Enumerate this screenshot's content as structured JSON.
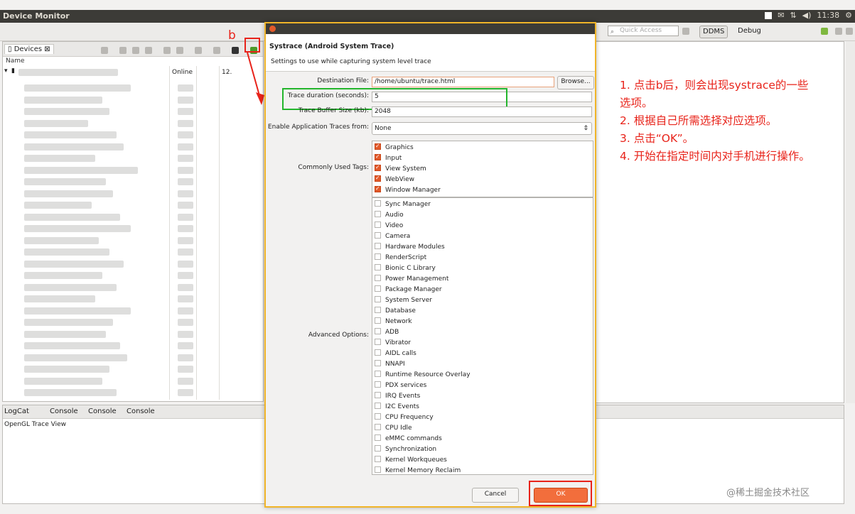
{
  "window": {
    "title": "Device Monitor"
  },
  "topbar": {
    "time": "11:38"
  },
  "toolbar": {
    "quick_access_placeholder": "Quick Access",
    "ddms_label": "DDMS",
    "debug_label": "Debug"
  },
  "devices": {
    "tab_label": "Devices",
    "col_name": "Name",
    "first_row_status": "Online",
    "first_row_version": "12."
  },
  "console_area": {
    "tabs": [
      "LogCat",
      "Console",
      "Console",
      "Console"
    ],
    "view_label": "OpenGL Trace View"
  },
  "annotation": {
    "marker": "b",
    "lines": [
      "1. 点击b后，则会出现systrace的一些",
      "选项。",
      "2. 根据自己所需选择对应选项。",
      "3. 点击“OK”。",
      "4. 开始在指定时间内对手机进行操作。"
    ]
  },
  "dialog": {
    "title": "Systrace (Android System Trace)",
    "subtitle": "Settings to use while capturing system level trace",
    "destination_label": "Destination File:",
    "destination_value": "/home/ubuntu/trace.html",
    "browse_label": "Browse...",
    "duration_label": "Trace duration (seconds):",
    "duration_value": "5",
    "buffer_label": "Trace Buffer Size (kb):",
    "buffer_value": "2048",
    "app_traces_label": "Enable Application Traces from:",
    "app_traces_value": "None",
    "common_label": "Commonly Used Tags:",
    "common_tags": [
      "Graphics",
      "Input",
      "View System",
      "WebView",
      "Window Manager"
    ],
    "advanced_label": "Advanced Options:",
    "advanced_tags": [
      "Sync Manager",
      "Audio",
      "Video",
      "Camera",
      "Hardware Modules",
      "RenderScript",
      "Bionic C Library",
      "Power Management",
      "Package Manager",
      "System Server",
      "Database",
      "Network",
      "ADB",
      "Vibrator",
      "AIDL calls",
      "NNAPI",
      "Runtime Resource Overlay",
      "PDX services",
      "IRQ Events",
      "I2C Events",
      "CPU Frequency",
      "CPU Idle",
      "eMMC commands",
      "Synchronization",
      "Kernel Workqueues",
      "Kernel Memory Reclaim"
    ],
    "cancel_label": "Cancel",
    "ok_label": "OK"
  },
  "watermark": "@稀土掘金技术社区",
  "colors": {
    "accent_orange": "#f26e3c",
    "annotation_red": "#e8231a",
    "highlight_green": "#23b52c",
    "dialog_border": "#f0b429"
  }
}
